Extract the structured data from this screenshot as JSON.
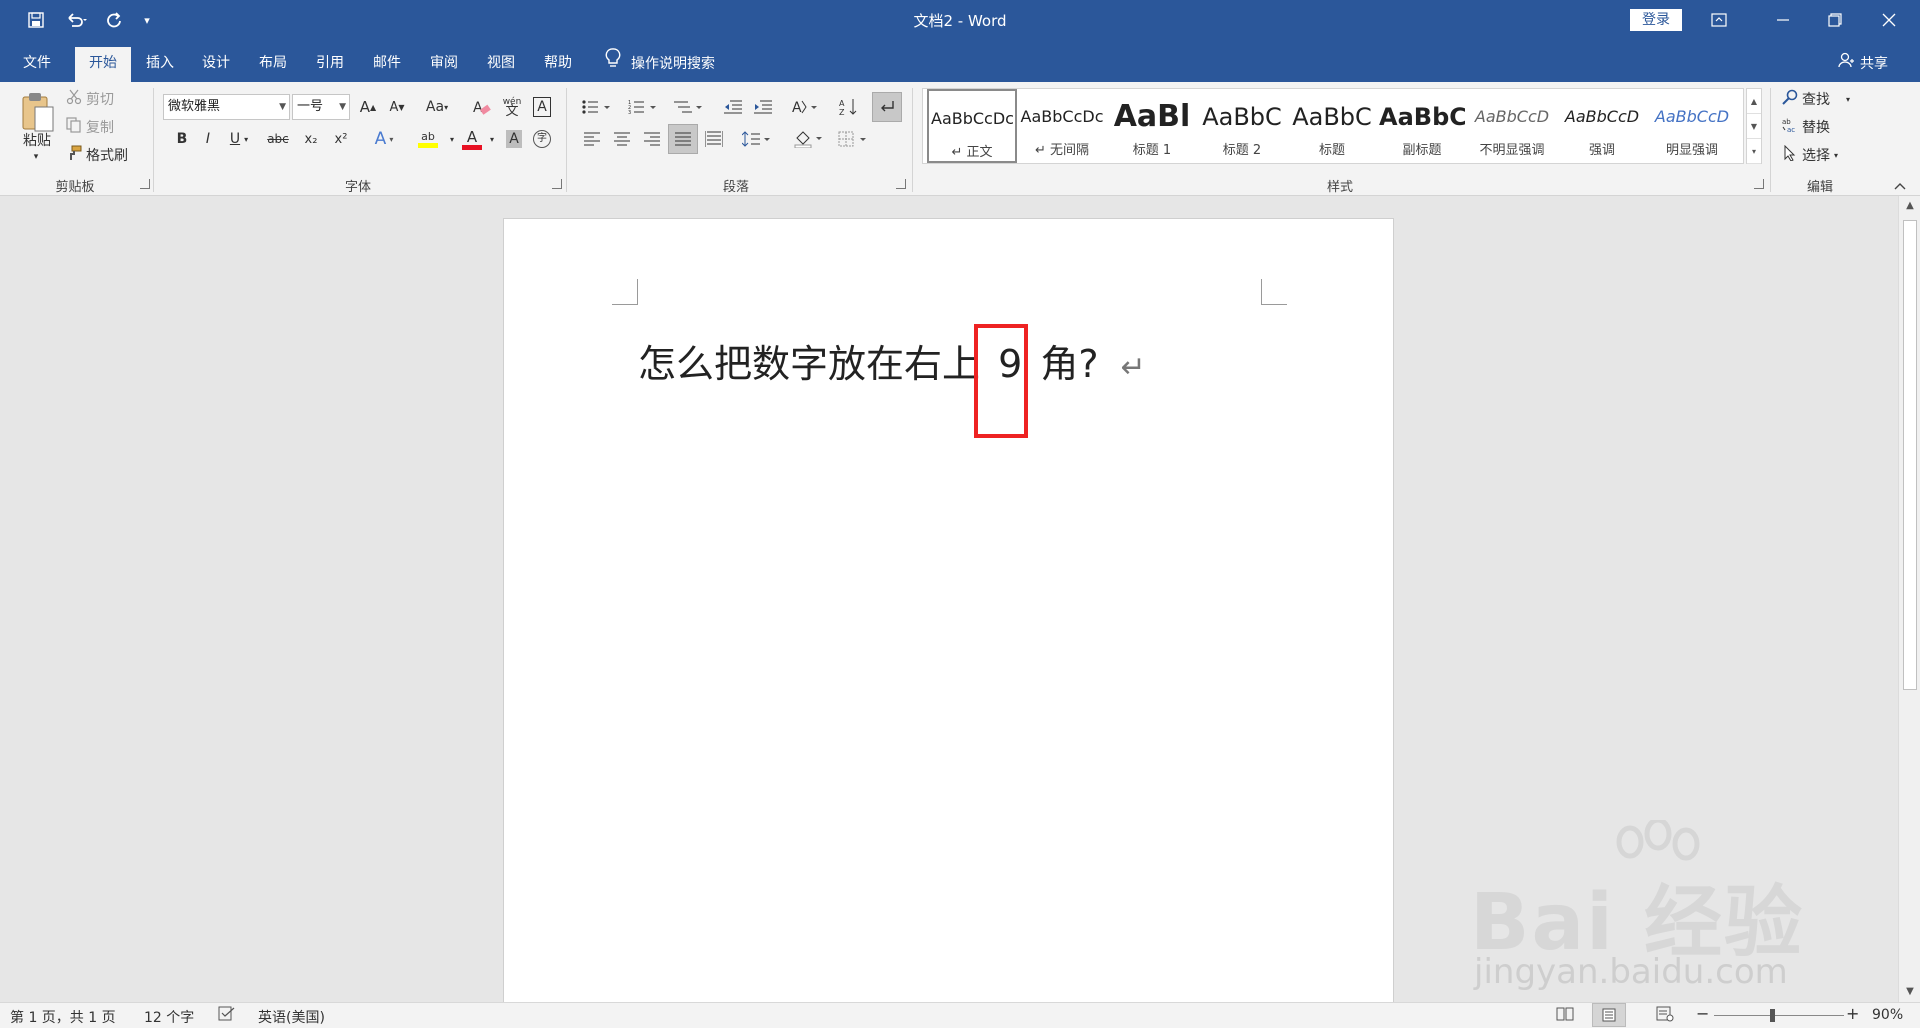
{
  "window": {
    "title": "文档2  -  Word",
    "login_label": "登录"
  },
  "tabs": [
    {
      "label": "文件",
      "active": false
    },
    {
      "label": "开始",
      "active": true
    },
    {
      "label": "插入",
      "active": false
    },
    {
      "label": "设计",
      "active": false
    },
    {
      "label": "布局",
      "active": false
    },
    {
      "label": "引用",
      "active": false
    },
    {
      "label": "邮件",
      "active": false
    },
    {
      "label": "审阅",
      "active": false
    },
    {
      "label": "视图",
      "active": false
    },
    {
      "label": "帮助",
      "active": false
    }
  ],
  "tell_me": "操作说明搜索",
  "share_label": "共享",
  "clipboard": {
    "group_label": "剪贴板",
    "paste_label": "粘贴",
    "cut_label": "剪切",
    "copy_label": "复制",
    "format_painter_label": "格式刷"
  },
  "font": {
    "group_label": "字体",
    "font_name": "微软雅黑",
    "font_size": "一号",
    "change_case": "Aa",
    "bold": "B",
    "italic": "I",
    "underline": "U",
    "strike": "abc",
    "subscript": "x₂",
    "superscript": "x²",
    "grow": "A",
    "shrink": "A",
    "phonetic": "wén",
    "char_border": "A",
    "text_effect": "A",
    "highlight": "ab",
    "font_color": "A",
    "char_shading": "A",
    "enclose": "字"
  },
  "paragraph": {
    "group_label": "段落"
  },
  "styles": {
    "group_label": "样式",
    "items": [
      {
        "sample": "AaBbCcDc",
        "name": "↵ 正文"
      },
      {
        "sample": "AaBbCcDc",
        "name": "↵ 无间隔"
      },
      {
        "sample": "AaBl",
        "name": "标题 1"
      },
      {
        "sample": "AaBbC",
        "name": "标题 2"
      },
      {
        "sample": "AaBbC",
        "name": "标题"
      },
      {
        "sample": "AaBbC",
        "name": "副标题"
      },
      {
        "sample": "AaBbCcD",
        "name": "不明显强调"
      },
      {
        "sample": "AaBbCcD",
        "name": "强调"
      },
      {
        "sample": "AaBbCcD",
        "name": "明显强调"
      }
    ]
  },
  "editing": {
    "group_label": "编辑",
    "find_label": "查找",
    "replace_label": "替换",
    "select_label": "选择"
  },
  "document": {
    "text_before": "怎么把数字放在右上",
    "highlighted": "9",
    "text_after": "角?",
    "paragraph_mark": "↵"
  },
  "status": {
    "page": "第 1 页，共 1 页",
    "words": "12 个字",
    "language": "英语(美国)",
    "zoom": "90%",
    "zoom_percent": 90
  },
  "watermark": {
    "brand": "Bai 经验",
    "url": "jingyan.baidu.com"
  },
  "colors": {
    "titlebar": "#2b579a",
    "ribbon": "#f3f3f3",
    "highlight_box": "#ee2222",
    "font_color_bar": "#e81123",
    "highlight_bar": "#ffff00"
  }
}
